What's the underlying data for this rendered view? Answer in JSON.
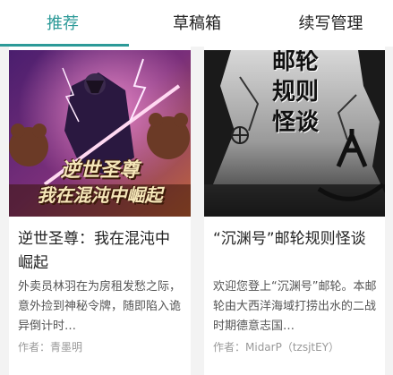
{
  "tabs": [
    {
      "label": "推荐",
      "active": true
    },
    {
      "label": "草稿箱",
      "active": false
    },
    {
      "label": "续写管理",
      "active": false
    }
  ],
  "accent_color": "#2c9a98",
  "books": [
    {
      "cover_text_line1": "逆世圣尊",
      "cover_text_line2": "我在混沌中崛起",
      "title": "逆世圣尊：我在混沌中崛起",
      "description": "外卖员林羽在为房租发愁之际，意外捡到神秘令牌，随即陷入诡异倒计时…",
      "author": "作者：青墨明"
    },
    {
      "cover_text_line1": "邮轮",
      "cover_text_line2": "规则",
      "cover_text_line3": "怪谈",
      "title": "“沉渊号”邮轮规则怪谈",
      "description": "欢迎您登上“沉渊号”邮轮。本邮轮由大西洋海域打捞出水的二战时期德意志国…",
      "author": "作者：MidarP（tzsjtEY）"
    }
  ]
}
